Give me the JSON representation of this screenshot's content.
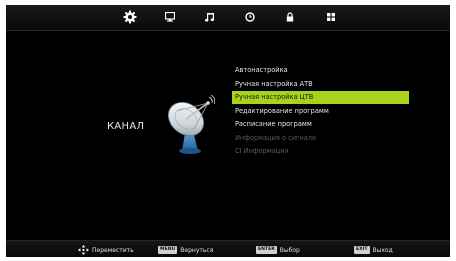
{
  "topbar": {
    "tabs": [
      {
        "icon": "gear-icon",
        "active": true
      },
      {
        "icon": "monitor-icon",
        "active": false
      },
      {
        "icon": "music-note-icon",
        "active": false
      },
      {
        "icon": "clock-icon",
        "active": false
      },
      {
        "icon": "lock-icon",
        "active": false
      },
      {
        "icon": "grid-icon",
        "active": false
      }
    ]
  },
  "section": {
    "title": "КАНАЛ",
    "icon": "satellite-dish-icon"
  },
  "menu": {
    "items": [
      {
        "label": "Автонастройка",
        "state": "normal"
      },
      {
        "label": "Ручная настройка АТВ",
        "state": "normal"
      },
      {
        "label": "Ручная настройка ЦТВ",
        "state": "selected"
      },
      {
        "label": "Редактирование программ",
        "state": "normal"
      },
      {
        "label": "Расписание программ",
        "state": "normal"
      },
      {
        "label": "Информация о сигнале",
        "state": "disabled"
      },
      {
        "label": "CI Информация",
        "state": "disabled"
      }
    ]
  },
  "footer": {
    "move_label": "Переместить",
    "menu_key": "MENU",
    "back_label": "Вернуться",
    "enter_key": "ENTER",
    "select_label": "Выбор",
    "exit_key": "EXIT",
    "exit_label": "Выход"
  },
  "colors": {
    "selected_bg": "#a9d21b",
    "background": "#000000",
    "text": "#e6e6e6",
    "disabled_text": "#5b5b5b"
  }
}
